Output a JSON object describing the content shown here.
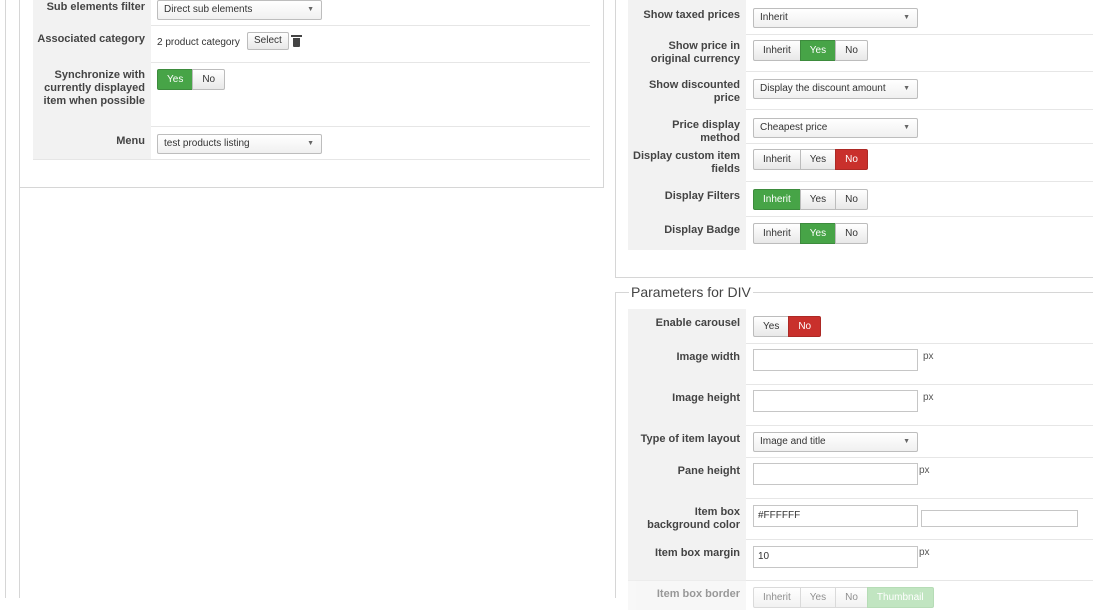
{
  "left": {
    "rows": [
      {
        "label": "Sub elements filter",
        "select": "Direct sub elements"
      },
      {
        "label": "Associated category",
        "value": "2 product category",
        "button": "Select",
        "icon": "trash-icon"
      },
      {
        "label": "Synchronize with currently displayed item when possible",
        "toggle": [
          "Yes",
          "No"
        ],
        "active": "Yes"
      },
      {
        "label": "Menu",
        "select": "test products listing"
      }
    ]
  },
  "right": {
    "rows": [
      {
        "label": "Show taxed prices",
        "select": "Inherit"
      },
      {
        "label": "Show price in original currency",
        "toggle": [
          "Inherit",
          "Yes",
          "No"
        ],
        "active": "Yes"
      },
      {
        "label": "Show discounted price",
        "select": "Display the discount amount"
      },
      {
        "label": "Price display method",
        "select": "Cheapest price"
      },
      {
        "label": "Display custom item fields",
        "toggle": [
          "Inherit",
          "Yes",
          "No"
        ],
        "active": "No"
      },
      {
        "label": "Display Filters",
        "toggle": [
          "Inherit",
          "Yes",
          "No"
        ],
        "active": "Inherit"
      },
      {
        "label": "Display Badge",
        "toggle": [
          "Inherit",
          "Yes",
          "No"
        ],
        "active": "Yes"
      }
    ]
  },
  "div_params": {
    "legend": "Parameters for DIV",
    "rows": [
      {
        "label": "Enable carousel",
        "toggle": [
          "Yes",
          "No"
        ],
        "active": "No"
      },
      {
        "label": "Image width",
        "value": "",
        "unit": "px"
      },
      {
        "label": "Image height",
        "value": "",
        "unit": "px"
      },
      {
        "label": "Type of item layout",
        "select": "Image and title"
      },
      {
        "label": "Pane height",
        "value": "",
        "unit": "px"
      },
      {
        "label": "Item box background color",
        "value": "#FFFFFF",
        "extra_value": ""
      },
      {
        "label": "Item box margin",
        "value": "10",
        "unit": "px"
      },
      {
        "label": "Item box border",
        "toggle": [
          "Inherit",
          "Yes",
          "No",
          "Thumbnail"
        ],
        "active": "Thumbnail"
      }
    ]
  },
  "colors": {
    "active_green": "#47a447",
    "active_red": "#c9302c",
    "label_bg": "#f2f2f2"
  },
  "select_arrow": "▼"
}
